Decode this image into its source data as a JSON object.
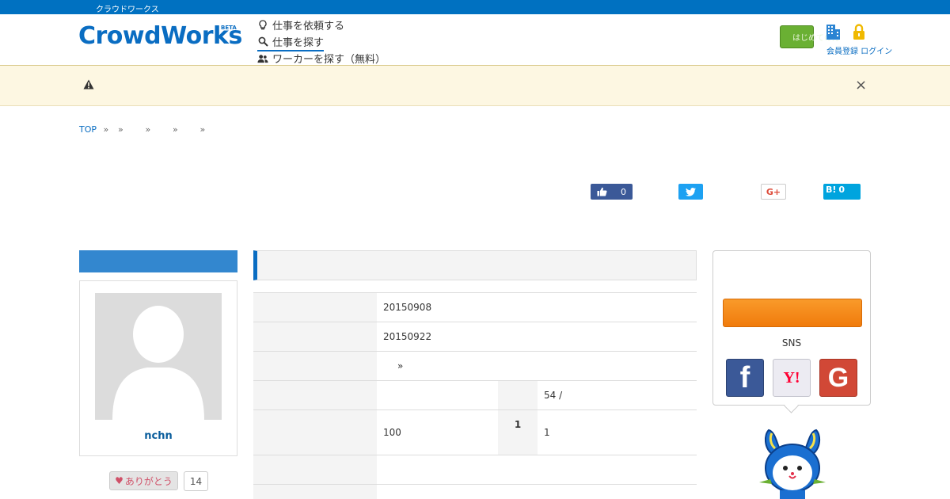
{
  "topbar": {
    "text": "クラウドワークス"
  },
  "header": {
    "logo": "CrowdWorks",
    "logo_badge": "BETA",
    "nav": [
      {
        "label": "仕事を依頼する",
        "icon": "lightbulb-icon"
      },
      {
        "label": "仕事を探す",
        "icon": "search-icon"
      },
      {
        "label": "ワーカーを探す（無料）",
        "icon": "users-icon"
      }
    ],
    "green_button_label": "はじめての方",
    "links": "会員登録 ログイン"
  },
  "notice": {
    "icon": "warning-icon",
    "close": "×"
  },
  "breadcrumb": {
    "top": "TOP",
    "separators": [
      "»",
      "»",
      "»",
      "»",
      "»"
    ]
  },
  "share": {
    "facebook_count": "0",
    "hatena_label": "B!",
    "hatena_count": "0",
    "google_label": "G+"
  },
  "profile": {
    "username": "nchn",
    "thanks_label": "ありがとう",
    "thanks_count": "14"
  },
  "details": {
    "rows": [
      {
        "value": "20150908"
      },
      {
        "value": "20150922"
      },
      {
        "value": "»"
      },
      {
        "value": "",
        "value2": "54 /"
      },
      {
        "value": "100",
        "label2": "1",
        "value2": "1"
      },
      {
        "value": ""
      }
    ]
  },
  "signup": {
    "sns_label": "SNS",
    "facebook": "f",
    "yahoo": "Y!",
    "google": "G"
  },
  "colors": {
    "brand": "#0a6dc2",
    "topbar": "#0071c1",
    "orange": "#f07b0c",
    "facebook": "#3b5998",
    "google": "#d14836"
  }
}
